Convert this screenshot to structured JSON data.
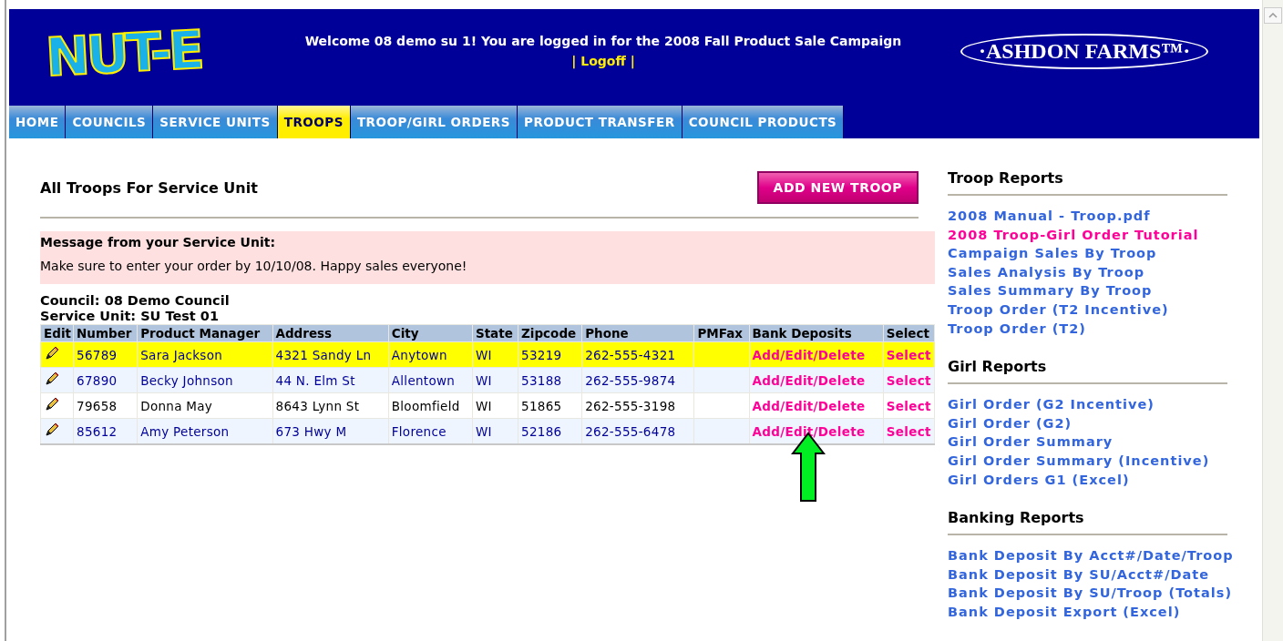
{
  "header": {
    "logo": "NUT-E",
    "welcome": "Welcome 08 demo su 1! You are logged in for the 2008 Fall Product Sale Campaign",
    "logoff": "| Logoff |",
    "brand_logo": "·ASHDON FARMS™·"
  },
  "tabs": [
    {
      "label": "HOME",
      "selected": false
    },
    {
      "label": "COUNCILS",
      "selected": false
    },
    {
      "label": "SERVICE UNITS",
      "selected": false
    },
    {
      "label": "TROOPS",
      "selected": true
    },
    {
      "label": "TROOP/GIRL ORDERS",
      "selected": false
    },
    {
      "label": "PRODUCT TRANSFER",
      "selected": false
    },
    {
      "label": "COUNCIL PRODUCTS",
      "selected": false
    }
  ],
  "page_title": "All Troops For Service Unit",
  "add_button": "ADD NEW TROOP",
  "message": {
    "title": "Message from your Service Unit:",
    "text": "Make sure to enter your order by 10/10/08. Happy sales everyone!"
  },
  "council": "Council: 08 Demo Council",
  "service_unit": "Service Unit: SU Test 01",
  "table": {
    "columns": [
      "Edit",
      "Number",
      "Product Manager",
      "Address",
      "City",
      "State",
      "Zipcode",
      "Phone",
      "PMFax",
      "Bank Deposits",
      "Select"
    ],
    "rows": [
      {
        "number": "56789",
        "manager": "Sara Jackson",
        "address": "4321 Sandy Ln",
        "city": "Anytown",
        "state": "WI",
        "zipcode": "53219",
        "phone": "262-555-4321",
        "bank": "Add/Edit/Delete",
        "select": "Select",
        "selected": true,
        "shaded": true
      },
      {
        "number": "67890",
        "manager": "Becky Johnson",
        "address": "44 N. Elm St",
        "city": "Allentown",
        "state": "WI",
        "zipcode": "53188",
        "phone": "262-555-9874",
        "bank": "Add/Edit/Delete",
        "select": "Select",
        "selected": false,
        "shaded": true
      },
      {
        "number": "79658",
        "manager": "Donna May",
        "address": "8643 Lynn St",
        "city": "Bloomfield",
        "state": "WI",
        "zipcode": "51865",
        "phone": "262-555-3198",
        "bank": "Add/Edit/Delete",
        "select": "Select",
        "selected": false,
        "shaded": false
      },
      {
        "number": "85612",
        "manager": "Amy Peterson",
        "address": "673 Hwy M",
        "city": "Florence",
        "state": "WI",
        "zipcode": "52186",
        "phone": "262-555-6478",
        "bank": "Add/Edit/Delete",
        "select": "Select",
        "selected": false,
        "shaded": true
      }
    ]
  },
  "sidebar": [
    {
      "title": "Troop Reports",
      "links": [
        {
          "label": "2008 Manual - Troop.pdf",
          "highlighted": false
        },
        {
          "label": "2008 Troop-Girl Order Tutorial",
          "highlighted": true
        },
        {
          "label": "Campaign Sales By Troop",
          "highlighted": false
        },
        {
          "label": "Sales Analysis By Troop",
          "highlighted": false
        },
        {
          "label": "Sales Summary By Troop",
          "highlighted": false
        },
        {
          "label": "Troop Order (T2 Incentive)",
          "highlighted": false
        },
        {
          "label": "Troop Order (T2)",
          "highlighted": false
        }
      ]
    },
    {
      "title": "Girl Reports",
      "links": [
        {
          "label": "Girl Order (G2 Incentive)",
          "highlighted": false
        },
        {
          "label": "Girl Order (G2)",
          "highlighted": false
        },
        {
          "label": "Girl Order Summary",
          "highlighted": false
        },
        {
          "label": "Girl Order Summary (Incentive)",
          "highlighted": false
        },
        {
          "label": "Girl Orders G1 (Excel)",
          "highlighted": false
        }
      ]
    },
    {
      "title": "Banking Reports",
      "links": [
        {
          "label": "Bank Deposit By Acct#/Date/Troop",
          "highlighted": false
        },
        {
          "label": "Bank Deposit By SU/Acct#/Date",
          "highlighted": false
        },
        {
          "label": "Bank Deposit By SU/Troop (Totals)",
          "highlighted": false
        },
        {
          "label": "Bank Deposit Export (Excel)",
          "highlighted": false
        }
      ]
    }
  ]
}
